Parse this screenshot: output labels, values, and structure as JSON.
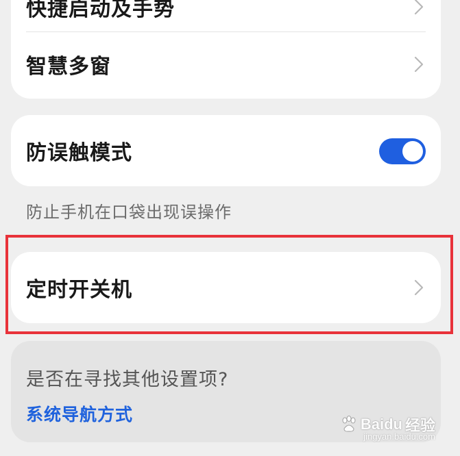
{
  "card1": {
    "items": [
      {
        "label": "快捷启动及手势"
      },
      {
        "label": "智慧多窗"
      }
    ]
  },
  "card2": {
    "label": "防误触模式",
    "toggle_on": true,
    "accent_color": "#1f5fe0"
  },
  "hint": "防止手机在口袋出现误操作",
  "card3": {
    "label": "定时开关机",
    "highlight_color": "#e8323a"
  },
  "search": {
    "question": "是否在寻找其他设置项?",
    "link": "系统导航方式"
  },
  "watermark": {
    "brand": "Baidu",
    "suffix": "经验",
    "url": "jingyan.baidu.com"
  }
}
